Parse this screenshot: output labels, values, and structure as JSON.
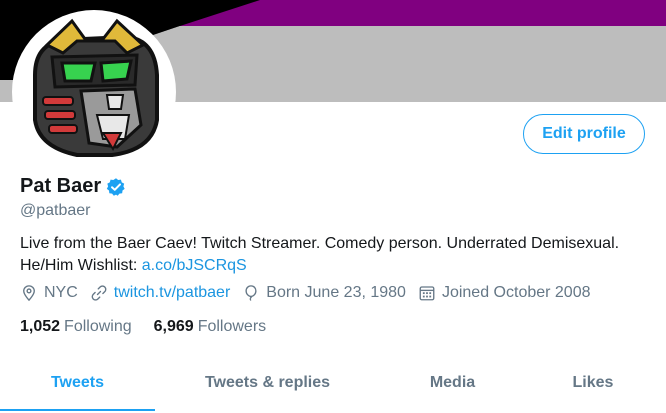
{
  "profile": {
    "name": "Pat Baer",
    "handle": "@patbaer",
    "verified_icon": "verified-badge-icon",
    "bio_text": "Live from the Baer Caev! Twitch Streamer. Comedy person. Underrated Demisexual. He/Him Wishlist: ",
    "bio_link": "a.co/bJSCRqS"
  },
  "actions": {
    "edit_profile_label": "Edit profile"
  },
  "meta": {
    "location": "NYC",
    "website": "twitch.tv/patbaer",
    "birthday": "Born June 23, 1980",
    "joined": "Joined October 2008",
    "icons": [
      "location-pin-icon",
      "link-icon",
      "balloon-icon",
      "calendar-icon"
    ]
  },
  "stats": {
    "following_count": "1,052",
    "following_label": "Following",
    "followers_count": "6,969",
    "followers_label": "Followers"
  },
  "tabs": [
    {
      "label": "Tweets",
      "active": true
    },
    {
      "label": "Tweets & replies",
      "active": false
    },
    {
      "label": "Media",
      "active": false
    },
    {
      "label": "Likes",
      "active": false
    }
  ],
  "colors": {
    "accent": "#1da1f2",
    "link": "#1b95e0",
    "muted": "#657786",
    "banner_stripes": [
      "#000000",
      "#a3a3a3",
      "#ffffff",
      "#800080"
    ]
  }
}
